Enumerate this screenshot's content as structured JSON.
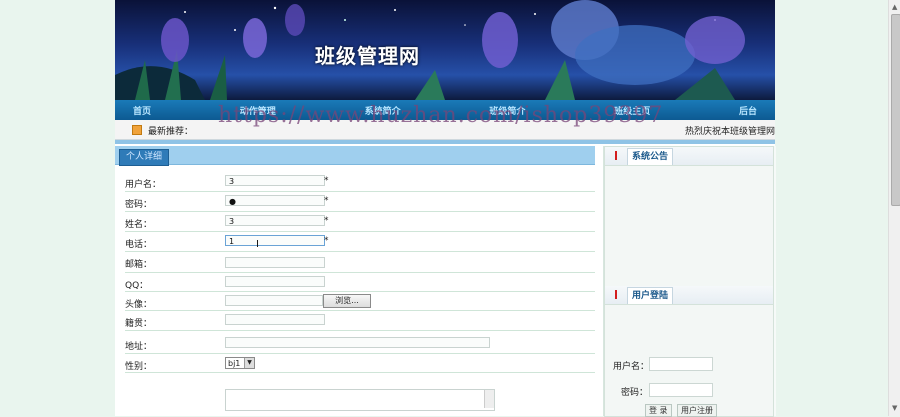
{
  "banner": {
    "title": "班级管理网"
  },
  "nav": [
    "首页",
    "动作管理",
    "系统简介",
    "班级简介",
    "班级主页",
    "后台"
  ],
  "news": {
    "label": "最新推荐：",
    "marquee": "热烈庆祝本班级管理网"
  },
  "watermark": "https://www.huzhan.com/ishop39397",
  "left_tab": "个人详细",
  "form": {
    "username": {
      "label": "用户名：",
      "value": "3",
      "required": "*"
    },
    "password": {
      "label": "密码：",
      "value": "●",
      "required": "*"
    },
    "name": {
      "label": "姓名：",
      "value": "3",
      "required": "*"
    },
    "phone": {
      "label": "电话：",
      "value": "1",
      "required": "*"
    },
    "email": {
      "label": "邮箱："
    },
    "qq": {
      "label": "QQ："
    },
    "avatar": {
      "label": "头像：",
      "button": "浏览..."
    },
    "hometown": {
      "label": "籍贯："
    },
    "address": {
      "label": "地址："
    },
    "gender": {
      "label": "性别：",
      "value": "bj1"
    }
  },
  "right": {
    "notice_title": "系统公告",
    "login_title": "用户登陆",
    "login_user_label": "用户名：",
    "login_pass_label": "密码：",
    "login_buttons": [
      "登 录",
      "用户注册"
    ]
  }
}
